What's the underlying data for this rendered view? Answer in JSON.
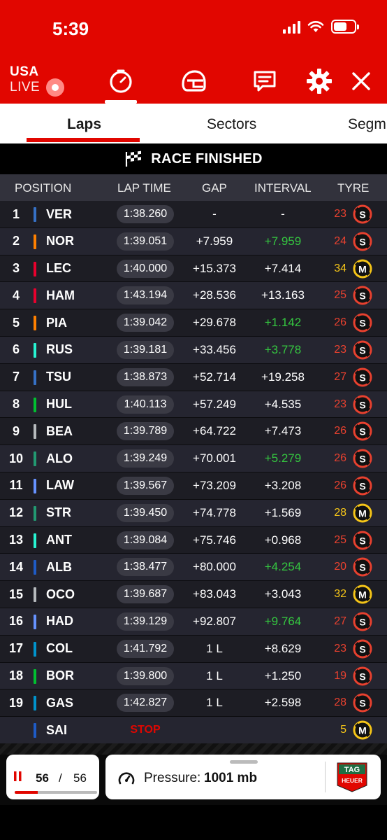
{
  "status": {
    "time": "5:39"
  },
  "header": {
    "live_country": "USA",
    "live_text": "LIVE",
    "icons": [
      "timer-icon",
      "helmet-icon",
      "message-icon",
      "gear-icon",
      "close-icon"
    ],
    "accent": "#e10600"
  },
  "tabs": [
    {
      "label": "Laps",
      "active": true
    },
    {
      "label": "Sectors",
      "active": false
    },
    {
      "label": "Segm",
      "active": false
    }
  ],
  "banner": {
    "text": "RACE FINISHED"
  },
  "table": {
    "columns": [
      "POSITION",
      "LAP TIME",
      "GAP",
      "INTERVAL",
      "TYRE"
    ],
    "rows": [
      {
        "pos": "1",
        "driver": "VER",
        "color": "#3671c6",
        "lap": "1:38.260",
        "gap": "-",
        "interval": "-",
        "green": false,
        "tyre_laps": "23",
        "compound": "S"
      },
      {
        "pos": "2",
        "driver": "NOR",
        "color": "#ff8000",
        "lap": "1:39.051",
        "gap": "+7.959",
        "interval": "+7.959",
        "green": true,
        "tyre_laps": "24",
        "compound": "S"
      },
      {
        "pos": "3",
        "driver": "LEC",
        "color": "#e8002d",
        "lap": "1:40.000",
        "gap": "+15.373",
        "interval": "+7.414",
        "green": false,
        "tyre_laps": "34",
        "compound": "M"
      },
      {
        "pos": "4",
        "driver": "HAM",
        "color": "#e8002d",
        "lap": "1:43.194",
        "gap": "+28.536",
        "interval": "+13.163",
        "green": false,
        "tyre_laps": "25",
        "compound": "S"
      },
      {
        "pos": "5",
        "driver": "PIA",
        "color": "#ff8000",
        "lap": "1:39.042",
        "gap": "+29.678",
        "interval": "+1.142",
        "green": true,
        "tyre_laps": "26",
        "compound": "S"
      },
      {
        "pos": "6",
        "driver": "RUS",
        "color": "#27f4d2",
        "lap": "1:39.181",
        "gap": "+33.456",
        "interval": "+3.778",
        "green": true,
        "tyre_laps": "23",
        "compound": "S"
      },
      {
        "pos": "7",
        "driver": "TSU",
        "color": "#3671c6",
        "lap": "1:38.873",
        "gap": "+52.714",
        "interval": "+19.258",
        "green": false,
        "tyre_laps": "27",
        "compound": "S"
      },
      {
        "pos": "8",
        "driver": "HUL",
        "color": "#00c030",
        "lap": "1:40.113",
        "gap": "+57.249",
        "interval": "+4.535",
        "green": false,
        "tyre_laps": "23",
        "compound": "S"
      },
      {
        "pos": "9",
        "driver": "BEA",
        "color": "#b6babd",
        "lap": "1:39.789",
        "gap": "+64.722",
        "interval": "+7.473",
        "green": false,
        "tyre_laps": "26",
        "compound": "S"
      },
      {
        "pos": "10",
        "driver": "ALO",
        "color": "#229971",
        "lap": "1:39.249",
        "gap": "+70.001",
        "interval": "+5.279",
        "green": true,
        "tyre_laps": "26",
        "compound": "S"
      },
      {
        "pos": "11",
        "driver": "LAW",
        "color": "#6692ff",
        "lap": "1:39.567",
        "gap": "+73.209",
        "interval": "+3.208",
        "green": false,
        "tyre_laps": "26",
        "compound": "S"
      },
      {
        "pos": "12",
        "driver": "STR",
        "color": "#229971",
        "lap": "1:39.450",
        "gap": "+74.778",
        "interval": "+1.569",
        "green": false,
        "tyre_laps": "28",
        "compound": "M"
      },
      {
        "pos": "13",
        "driver": "ANT",
        "color": "#27f4d2",
        "lap": "1:39.084",
        "gap": "+75.746",
        "interval": "+0.968",
        "green": false,
        "tyre_laps": "25",
        "compound": "S"
      },
      {
        "pos": "14",
        "driver": "ALB",
        "color": "#1e5bc6",
        "lap": "1:38.477",
        "gap": "+80.000",
        "interval": "+4.254",
        "green": true,
        "tyre_laps": "20",
        "compound": "S"
      },
      {
        "pos": "15",
        "driver": "OCO",
        "color": "#b6babd",
        "lap": "1:39.687",
        "gap": "+83.043",
        "interval": "+3.043",
        "green": false,
        "tyre_laps": "32",
        "compound": "M"
      },
      {
        "pos": "16",
        "driver": "HAD",
        "color": "#6692ff",
        "lap": "1:39.129",
        "gap": "+92.807",
        "interval": "+9.764",
        "green": true,
        "tyre_laps": "27",
        "compound": "S"
      },
      {
        "pos": "17",
        "driver": "COL",
        "color": "#0093cc",
        "lap": "1:41.792",
        "gap": "1 L",
        "interval": "+8.629",
        "green": false,
        "tyre_laps": "23",
        "compound": "S"
      },
      {
        "pos": "18",
        "driver": "BOR",
        "color": "#00c030",
        "lap": "1:39.800",
        "gap": "1 L",
        "interval": "+1.250",
        "green": false,
        "tyre_laps": "19",
        "compound": "S"
      },
      {
        "pos": "19",
        "driver": "GAS",
        "color": "#0093cc",
        "lap": "1:42.827",
        "gap": "1 L",
        "interval": "+2.598",
        "green": false,
        "tyre_laps": "28",
        "compound": "S"
      },
      {
        "pos": "",
        "driver": "SAI",
        "color": "#1e5bc6",
        "lap": "STOP",
        "gap": "",
        "interval": "",
        "green": false,
        "tyre_laps": "5",
        "compound": "M",
        "stopped": true
      }
    ]
  },
  "tyre_colors": {
    "S": "#e8412f",
    "M": "#f5c518"
  },
  "footer": {
    "current_lap": "56",
    "separator": "/",
    "total_laps": "56",
    "lap_progress": 0.28,
    "pressure_label": "Pressure:",
    "pressure_value": "1001 mb",
    "sponsor_logo": "tag-heuer-logo",
    "sponsor_text_top": "TAG",
    "sponsor_text_bottom": "HEUER"
  }
}
